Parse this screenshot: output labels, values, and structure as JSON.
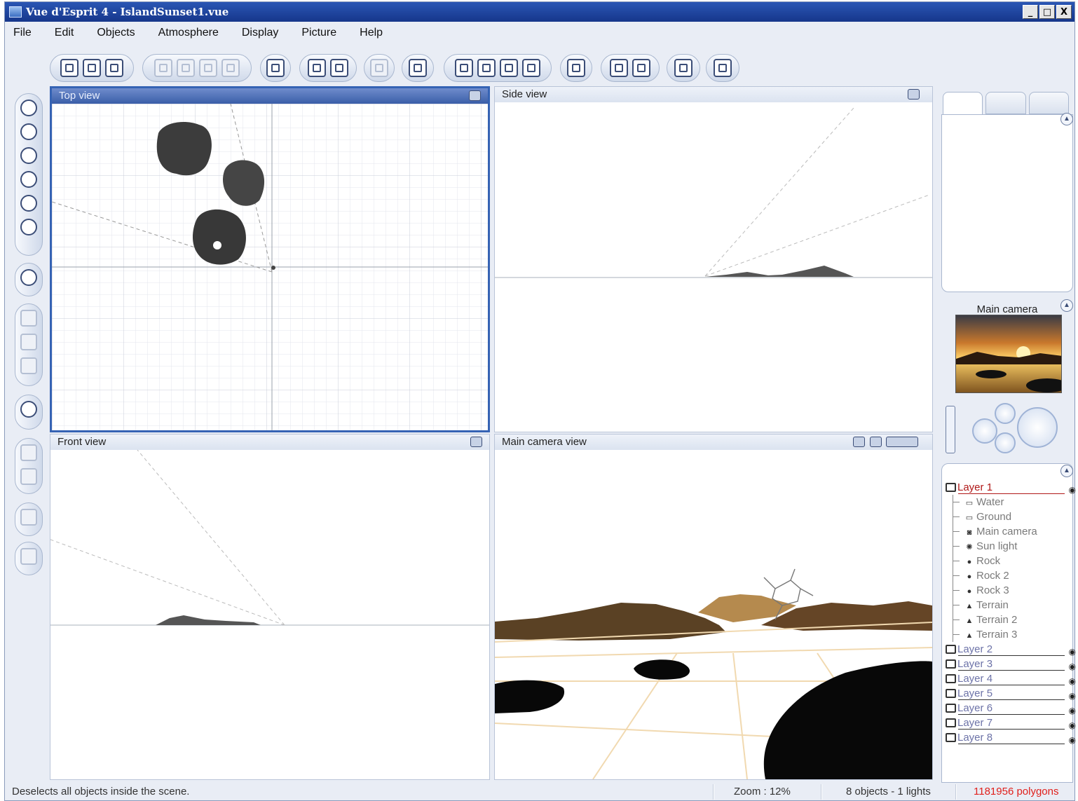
{
  "window": {
    "title": "Vue d'Esprit 4 - IslandSunset1.vue",
    "controls": [
      "_",
      "□",
      "X"
    ]
  },
  "menu": [
    "File",
    "Edit",
    "Objects",
    "Atmosphere",
    "Display",
    "Picture",
    "Help"
  ],
  "viewports": {
    "top": {
      "label": "Top view"
    },
    "side": {
      "label": "Side view"
    },
    "front": {
      "label": "Front view"
    },
    "camera": {
      "label": "Main camera view"
    }
  },
  "camera_panel": {
    "label": "Main camera"
  },
  "layers": [
    {
      "name": "Layer 1",
      "expanded": true,
      "children": [
        {
          "name": "Water",
          "icon": "plane-icon"
        },
        {
          "name": "Ground",
          "icon": "plane-icon"
        },
        {
          "name": "Main camera",
          "icon": "camera-icon"
        },
        {
          "name": "Sun light",
          "icon": "sun-icon"
        },
        {
          "name": "Rock",
          "icon": "rock-icon"
        },
        {
          "name": "Rock 2",
          "icon": "rock-icon"
        },
        {
          "name": "Rock 3",
          "icon": "rock-icon"
        },
        {
          "name": "Terrain",
          "icon": "terrain-icon"
        },
        {
          "name": "Terrain 2",
          "icon": "terrain-icon"
        },
        {
          "name": "Terrain 3",
          "icon": "terrain-icon"
        }
      ]
    },
    {
      "name": "Layer 2"
    },
    {
      "name": "Layer 3"
    },
    {
      "name": "Layer 4"
    },
    {
      "name": "Layer 5"
    },
    {
      "name": "Layer 6"
    },
    {
      "name": "Layer 7"
    },
    {
      "name": "Layer 8"
    }
  ],
  "status": {
    "message": "Deselects all objects inside the scene.",
    "zoom": "Zoom : 12%",
    "counts": "8 objects - 1 lights",
    "polygons": "1181956 polygons"
  },
  "colors": {
    "title_bar": "#16368b",
    "active_viewport": "#3563b4",
    "polygons_text": "#e0201c",
    "layer_text": "#b01818"
  }
}
